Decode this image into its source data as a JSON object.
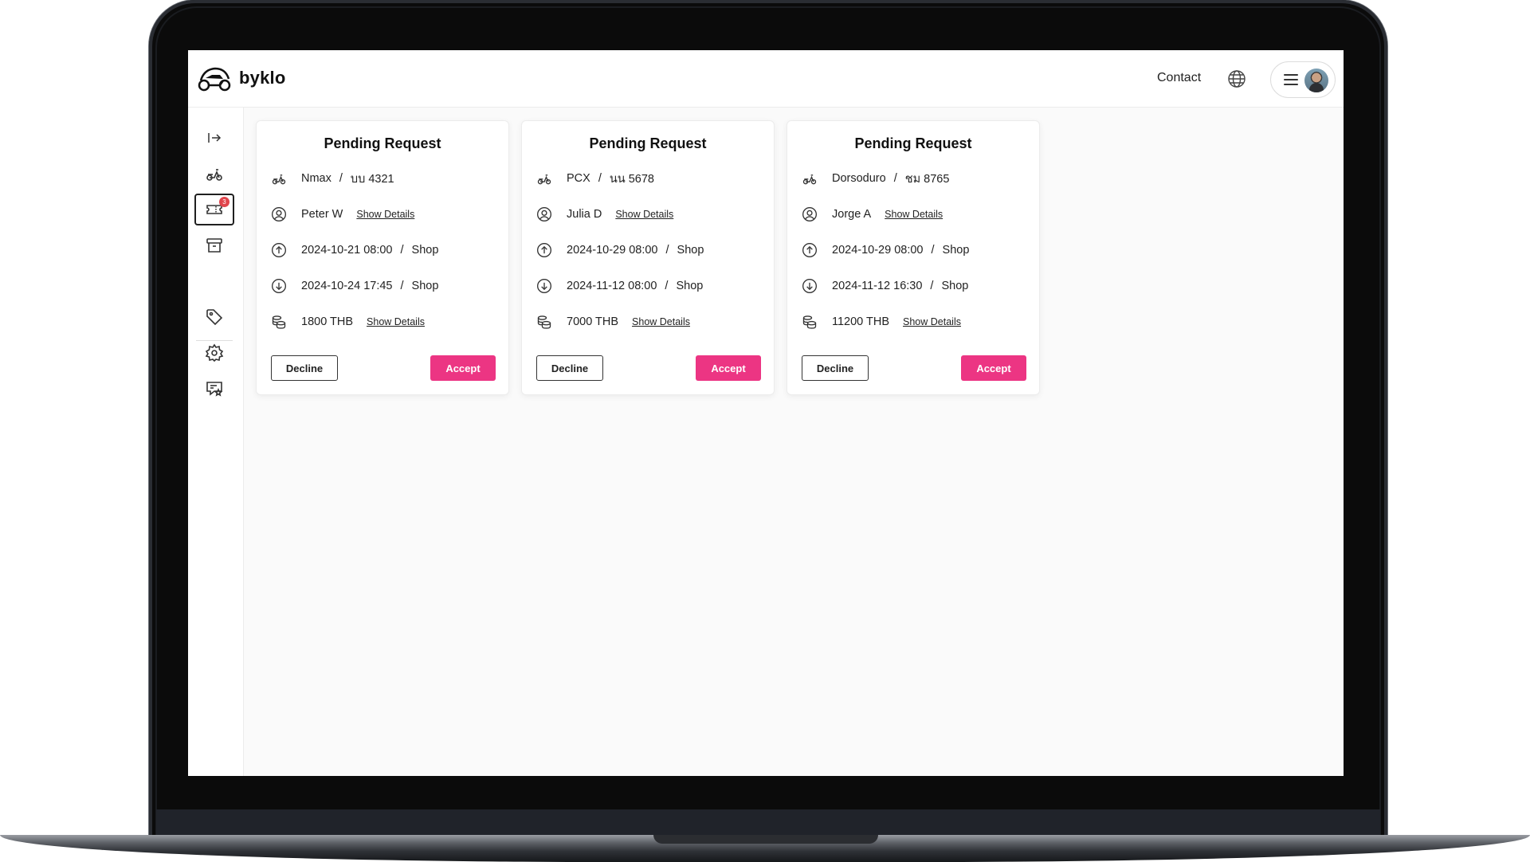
{
  "app": {
    "name": "byklo"
  },
  "header": {
    "contact_label": "Contact"
  },
  "sidebar": {
    "items": [
      {
        "name": "collapse",
        "icon": "expand-sidebar-icon"
      },
      {
        "name": "bikes",
        "icon": "scooter-icon"
      },
      {
        "name": "requests",
        "icon": "ticket-icon",
        "badge": "3"
      },
      {
        "name": "archive",
        "icon": "archive-box-icon"
      },
      {
        "name": "pricing",
        "icon": "tag-icon"
      },
      {
        "name": "settings",
        "icon": "gear-icon"
      },
      {
        "name": "reviews",
        "icon": "review-star-icon"
      }
    ]
  },
  "cards": [
    {
      "title": "Pending Request",
      "bike": "Nmax",
      "plate": "บบ 4321",
      "customer": "Peter W",
      "pickup": "2024-10-21 08:00",
      "pickup_location": "Shop",
      "dropoff": "2024-10-24 17:45",
      "dropoff_location": "Shop",
      "price": "1800 THB",
      "details_label": "Show Details",
      "decline_label": "Decline",
      "accept_label": "Accept"
    },
    {
      "title": "Pending Request",
      "bike": "PCX",
      "plate": "นน 5678",
      "customer": "Julia D",
      "pickup": "2024-10-29 08:00",
      "pickup_location": "Shop",
      "dropoff": "2024-11-12 08:00",
      "dropoff_location": "Shop",
      "price": "7000 THB",
      "details_label": "Show Details",
      "decline_label": "Decline",
      "accept_label": "Accept"
    },
    {
      "title": "Pending Request",
      "bike": "Dorsoduro",
      "plate": "ชม 8765",
      "customer": "Jorge A",
      "pickup": "2024-10-29 08:00",
      "pickup_location": "Shop",
      "dropoff": "2024-11-12 16:30",
      "dropoff_location": "Shop",
      "price": "11200 THB",
      "details_label": "Show Details",
      "decline_label": "Decline",
      "accept_label": "Accept"
    }
  ],
  "colors": {
    "accent": "#ec3583",
    "badge": "#e0454c",
    "text": "#1f1f1f"
  }
}
